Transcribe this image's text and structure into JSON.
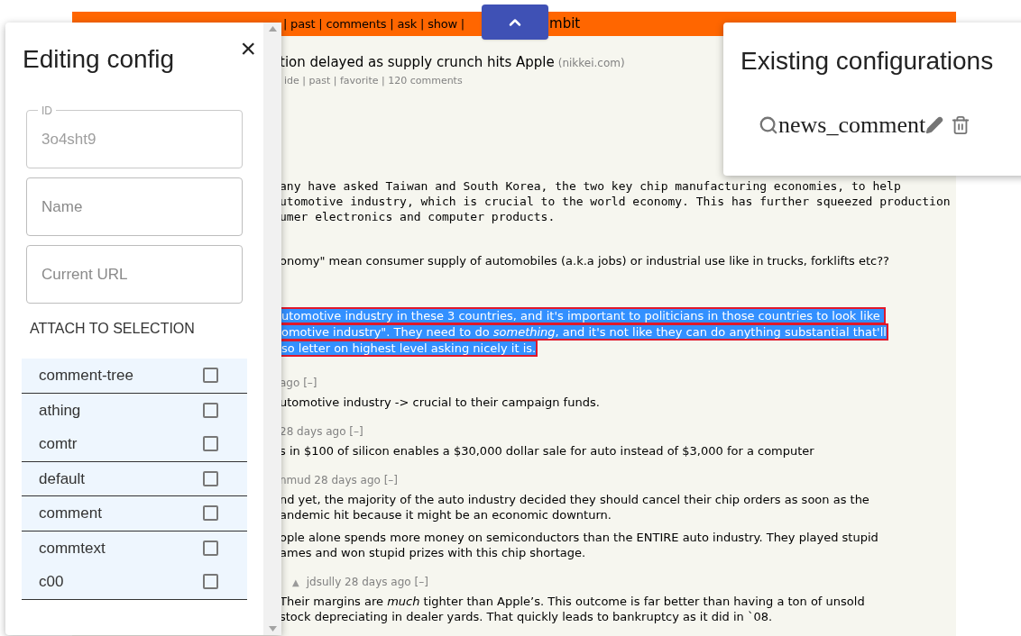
{
  "news_page": {
    "header": {
      "nav_left": "| past | comments | ask | show |",
      "nav_right": "mbit"
    },
    "story": {
      "title": "tion delayed as supply crunch hits Apple",
      "domain": "(nikkei.com)",
      "subtext": "ide | past | favorite | 120 comments"
    },
    "blocks": [
      {
        "kind": "mono",
        "lines": [
          "any have asked Taiwan and South Korea, the two key chip manufacturing economies, to help",
          "utomotive industry, which is crucial to the world economy. This has further squeezed production",
          "umer electronics and computer products."
        ]
      },
      {
        "kind": "text",
        "lines": [
          "onomy\" mean consumer supply of automobiles (a.k.a jobs) or industrial use like in trucks, forklifts etc??"
        ]
      },
      {
        "kind": "selected",
        "lines": [
          "utomotive industry in these 3 countries, and it's important to politicians in those countries to look like ",
          "omotive industry\". They need to do *something*, and it's not like they can do anything substantial that'll",
          "so letter on highest level asking nicely it is."
        ]
      },
      {
        "kind": "meta",
        "text": "ago [–]"
      },
      {
        "kind": "text",
        "lines": [
          "utomotive industry -> crucial to their campaign funds."
        ]
      },
      {
        "kind": "meta",
        "text": "28 days ago [–]"
      },
      {
        "kind": "text",
        "lines": [
          "s in $100 of silicon enables a $30,000 dollar sale for auto instead of $3,000 for a computer"
        ]
      },
      {
        "kind": "meta",
        "text": "nmud 28 days ago [–]"
      },
      {
        "kind": "text",
        "lines": [
          "nd yet, the majority of the auto industry decided they should cancel their chip orders as soon as the",
          "andemic hit because it might be an economic downturn."
        ]
      },
      {
        "kind": "text",
        "lines": [
          "ople alone spends more money on semiconductors than the ENTIRE auto industry. They played stupid",
          "ames and won stupid prizes with this chip shortage."
        ],
        "children": [
          {
            "kind": "meta",
            "vote": "▲",
            "text": "jdsully 28 days ago [–]"
          },
          {
            "kind": "text",
            "lines": [
              "Their margins are *much* tighter than Apple’s. This outcome is far better than having a ton of unsold",
              "stock depreciating in dealer yards. That quickly leads to bankruptcy as it did in `08."
            ]
          }
        ]
      }
    ]
  },
  "editor_panel": {
    "title": "Editing config",
    "close": "×",
    "fields": [
      {
        "label": "ID",
        "value": "3o4sht9",
        "disabled": true
      },
      {
        "placeholder": "Name"
      },
      {
        "placeholder": "Current URL"
      }
    ],
    "section_title": "ATTACH TO SELECTION",
    "selector_groups": [
      [
        {
          "label": "comment-tree",
          "checked": false
        }
      ],
      [
        {
          "label": "athing",
          "checked": false
        },
        {
          "label": "comtr",
          "checked": false
        }
      ],
      [
        {
          "label": "default",
          "checked": false
        }
      ],
      [
        {
          "label": "comment",
          "checked": false
        }
      ],
      [
        {
          "label": "commtext",
          "checked": false
        },
        {
          "label": "c00",
          "checked": false
        }
      ]
    ]
  },
  "configs_panel": {
    "title": "Existing configurations",
    "items": [
      {
        "name": "news_comment"
      }
    ]
  }
}
